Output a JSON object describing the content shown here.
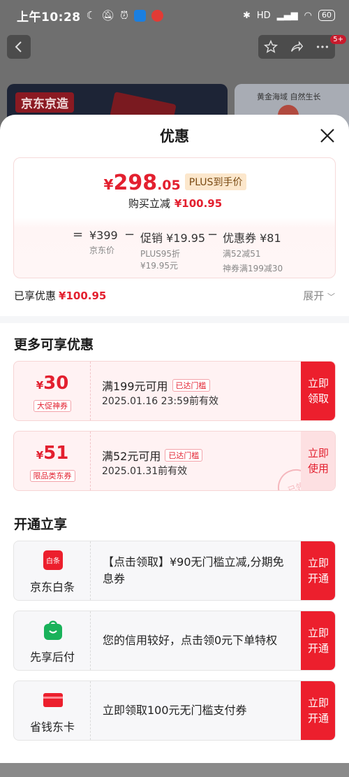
{
  "status_bar": {
    "time": "上午10:28",
    "network": "HD",
    "battery": "60"
  },
  "nav": {
    "notification_count": "5+"
  },
  "banner": {
    "logo_text": "京东京造",
    "right_text": "黄金海域 自然生长"
  },
  "sheet": {
    "title": "优惠",
    "price_card": {
      "currency": "¥",
      "price_int": "298",
      "price_dec": ".05",
      "plus_tag": "PLUS到手价",
      "instant_label": "购买立减",
      "instant_value": "¥100.95",
      "eq": "=",
      "minus": "−",
      "items": [
        {
          "label": "¥399",
          "sub1": "京东价",
          "sub2": ""
        },
        {
          "label": "促销 ¥19.95",
          "sub1": "PLUS95折",
          "sub2": "¥19.95元"
        },
        {
          "label": "优惠券 ¥81",
          "sub1": "满52减51",
          "sub2": "神券满199减30"
        }
      ]
    },
    "saved": {
      "label": "已享优惠",
      "value": "¥100.95"
    },
    "expand": "展开",
    "more_title": "更多可享优惠",
    "coupons": [
      {
        "currency": "¥",
        "amount": "30",
        "type": "大促神券",
        "condition": "满199元可用",
        "tag": "已达门槛",
        "validity": "2025.01.16 23:59前有效",
        "button": "立即 领取"
      },
      {
        "currency": "¥",
        "amount": "51",
        "type": "限品类东券",
        "condition": "满52元可用",
        "tag": "已达门槛",
        "validity": "2025.01.31前有效",
        "button": "立即 使用",
        "stamp": "已领"
      }
    ],
    "open_title": "开通立享",
    "services": [
      {
        "name": "京东白条",
        "icon_text": "白条",
        "desc": "【点击领取】¥90无门槛立减,分期免息券",
        "button": "立即 开通"
      },
      {
        "name": "先享后付",
        "desc": "您的信用较好，点击领0元下单特权",
        "button": "立即 开通"
      },
      {
        "name": "省钱东卡",
        "desc": "立即领取100元无门槛支付券",
        "button": "立即 开通"
      }
    ]
  },
  "colors": {
    "accent": "#e3202f",
    "button_red": "#ec1f2d",
    "plus_bg": "#fce7cc"
  }
}
